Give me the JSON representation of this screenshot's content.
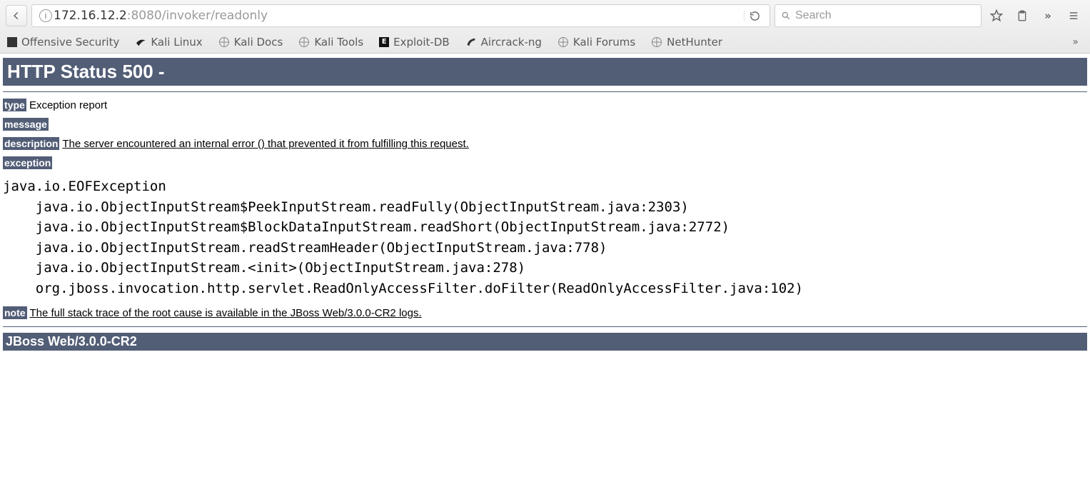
{
  "browser": {
    "url_host": "172.16.12.2",
    "url_path": ":8080/invoker/readonly",
    "search_placeholder": "Search",
    "bookmarks": [
      "Offensive Security",
      "Kali Linux",
      "Kali Docs",
      "Kali Tools",
      "Exploit-DB",
      "Aircrack-ng",
      "Kali Forums",
      "NetHunter"
    ]
  },
  "error": {
    "status_header": "HTTP Status 500 -",
    "labels": {
      "type": "type",
      "message": "message",
      "description": "description",
      "exception": "exception",
      "note": "note"
    },
    "type_text": " Exception report",
    "message_text": "",
    "description_text": "The server encountered an internal error () that prevented it from fulfilling this request.",
    "stack": "java.io.EOFException\n    java.io.ObjectInputStream$PeekInputStream.readFully(ObjectInputStream.java:2303)\n    java.io.ObjectInputStream$BlockDataInputStream.readShort(ObjectInputStream.java:2772)\n    java.io.ObjectInputStream.readStreamHeader(ObjectInputStream.java:778)\n    java.io.ObjectInputStream.<init>(ObjectInputStream.java:278)\n    org.jboss.invocation.http.servlet.ReadOnlyAccessFilter.doFilter(ReadOnlyAccessFilter.java:102)",
    "note_text": "The full stack trace of the root cause is available in the JBoss Web/3.0.0-CR2 logs.",
    "server_footer": "JBoss Web/3.0.0-CR2"
  }
}
